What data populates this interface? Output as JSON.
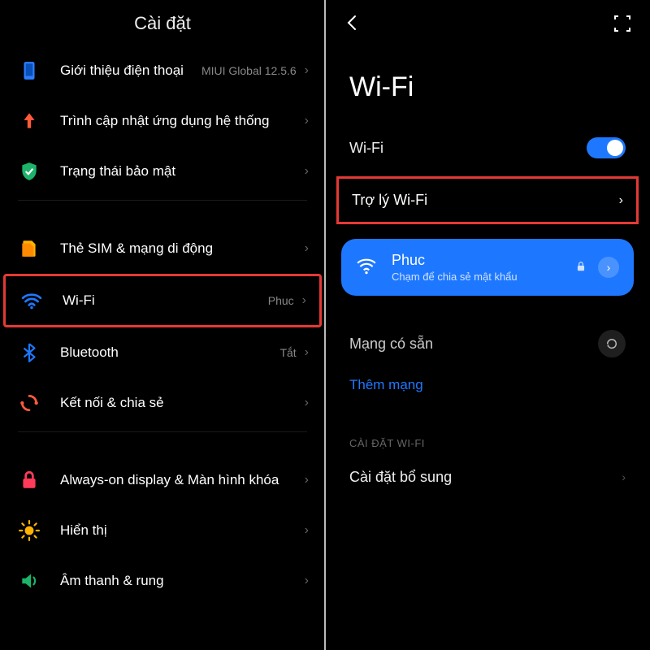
{
  "left": {
    "title": "Cài đặt",
    "items": [
      {
        "label": "Giới thiệu điện thoại",
        "meta": "MIUI Global 12.5.6",
        "icon": "phone-icon"
      },
      {
        "label": "Trình cập nhật ứng dụng hệ thống",
        "meta": "",
        "icon": "update-icon"
      },
      {
        "label": "Trạng thái bảo mật",
        "meta": "",
        "icon": "shield-icon"
      },
      {
        "label": "Thẻ SIM & mạng di động",
        "meta": "",
        "icon": "sim-icon"
      },
      {
        "label": "Wi-Fi",
        "meta": "Phuc",
        "icon": "wifi-icon"
      },
      {
        "label": "Bluetooth",
        "meta": "Tắt",
        "icon": "bluetooth-icon"
      },
      {
        "label": "Kết nối & chia sẻ",
        "meta": "",
        "icon": "share-icon"
      },
      {
        "label": "Always-on display & Màn hình khóa",
        "meta": "",
        "icon": "lock-icon"
      },
      {
        "label": "Hiển thị",
        "meta": "",
        "icon": "brightness-icon"
      },
      {
        "label": "Âm thanh & rung",
        "meta": "",
        "icon": "sound-icon"
      }
    ]
  },
  "right": {
    "title": "Wi-Fi",
    "wifi_label": "Wi-Fi",
    "assistant_label": "Trợ lý Wi-Fi",
    "connected": {
      "name": "Phuc",
      "sub": "Chạm để chia sẻ mật khẩu"
    },
    "available_label": "Mạng có sẵn",
    "add_network": "Thêm mạng",
    "section_head": "CÀI ĐẶT WI-FI",
    "extra_settings": "Cài đặt bổ sung"
  }
}
